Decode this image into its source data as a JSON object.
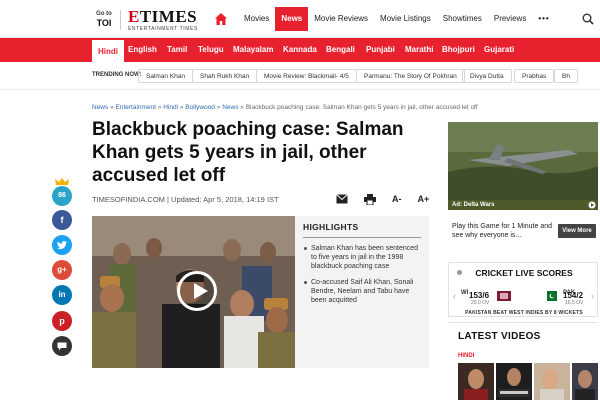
{
  "header": {
    "goto_line1": "Go to",
    "goto_line2": "TOI",
    "logo_main": "ETIMES",
    "logo_sub": "ENTERTAINMENT TIMES",
    "nav": [
      "Movies",
      "News",
      "Movie Reviews",
      "Movie Listings",
      "Showtimes",
      "Previews"
    ],
    "active_nav": "News",
    "more_dots": "•••"
  },
  "languages": [
    "Hindi",
    "English",
    "Tamil",
    "Telugu",
    "Malayalam",
    "Kannada",
    "Bengali",
    "Punjabi",
    "Marathi",
    "Bhojpuri",
    "Gujarati"
  ],
  "active_language": "Hindi",
  "trending": {
    "label": "TRENDING NOW:",
    "items": [
      "Salman Khan",
      "Shah Rukh Khan",
      "Movie Review: Blackmail- 4/5",
      "Parmanu: The Story Of Pokhran",
      "Divya Dutta",
      "Prabhas",
      "Bh"
    ]
  },
  "breadcrumb": {
    "links": [
      "News",
      "Entertainment",
      "Hindi",
      "Bollywood",
      "News"
    ],
    "separator": "»",
    "current": "Blackbuck poaching case: Salman Khan gets 5 years in jail, other accused let off"
  },
  "article": {
    "headline": "Blackbuck poaching case: Salman Khan gets 5 years in jail, other accused let off",
    "byline": "TIMESOFINDIA.COM | Updated: Apr 5, 2018, 14:19 IST",
    "font_decrease": "A-",
    "font_increase": "A+"
  },
  "social": {
    "count": "86",
    "buttons": [
      "f",
      "t",
      "g+",
      "in",
      "p",
      "comment"
    ]
  },
  "highlights": {
    "title": "HIGHLIGHTS",
    "items": [
      "Salman Khan has been sentenced to five years in jail in the 1998 blackbuck poaching case",
      "Co-accused Saif Ali Khan, Sonali Bendre, Neelam and Tabu have been acquitted"
    ]
  },
  "ad": {
    "label": "Ad: Delta Wars",
    "text": "Play this Game for 1 Minute and see why everyone is...",
    "button": "View More"
  },
  "cricket": {
    "title": "CRICKET LIVE SCORES",
    "team1": "WI",
    "score1": "153/6",
    "overs1": "20.0 OV",
    "team2": "PAK",
    "score2": "154/2",
    "overs2": "16.5 OV",
    "result": "PAKISTAN BEAT WEST INDIES BY 8 WICKETS"
  },
  "latest_videos": {
    "title": "LATEST VIDEOS",
    "category": "HINDI"
  },
  "colors": {
    "brand_red": "#e8212e",
    "facebook": "#3b5998",
    "twitter": "#1da1f2",
    "google": "#dd4b39",
    "linkedin": "#0077b5",
    "pinterest": "#cb2027",
    "comment": "#333333",
    "count": "#2aa4c9"
  }
}
